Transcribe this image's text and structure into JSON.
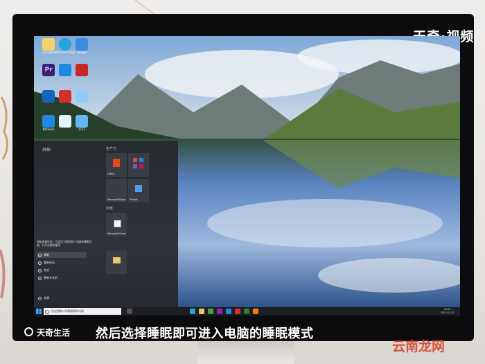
{
  "colors": {
    "accent": "#d9432c",
    "screen_bg": "#2f5e9a",
    "taskbar": "#1e1f23",
    "start_menu": "#26282c"
  },
  "brand_corner": "天奇·视频",
  "desktop_icons": [
    {
      "label": "Calculator",
      "icon": "calc-icon",
      "color": "#f5d36b"
    },
    {
      "label": "Microsoft Edge",
      "icon": "edge-icon",
      "color": "#2aa3d8"
    },
    {
      "label": "Google",
      "icon": "app-icon",
      "color": "#3d8be0"
    },
    {
      "label": "Pr",
      "icon": "premiere-icon",
      "color": "#3a1f6e"
    },
    {
      "label": "",
      "icon": "app-icon",
      "color": "#1e88e5"
    },
    {
      "label": "",
      "icon": "app-icon",
      "color": "#c62828"
    },
    {
      "label": "",
      "icon": "app-icon",
      "color": "#1565c0"
    },
    {
      "label": "",
      "icon": "app-icon",
      "color": "#d32f2f"
    },
    {
      "label": "",
      "icon": "app-icon",
      "color": "#90caf9"
    },
    {
      "label": "Network",
      "icon": "network-icon",
      "color": "#1e88e5"
    },
    {
      "label": "",
      "icon": "app-icon",
      "color": "#e3f2fd"
    },
    {
      "label": "ICST",
      "icon": "app-icon",
      "color": "#64b5f6"
    }
  ],
  "start_menu": {
    "title": "开始",
    "section_label": "生产力",
    "tiles": [
      {
        "label": "Office",
        "color": "#3a3d44",
        "icon": "office-icon"
      },
      {
        "label": "",
        "color": "#3a3d44",
        "icon": "apps-grid-icon"
      },
      {
        "label": "Microsoft Edge",
        "color": "#3a3d44",
        "icon": "edge-icon"
      },
      {
        "label": "Photos",
        "color": "#3a3d44",
        "icon": "photos-icon"
      },
      {
        "label": "Microsoft Store",
        "color": "#3a3d44",
        "icon": "store-icon"
      },
      {
        "label": "",
        "color": "#3a3d44",
        "icon": "folder-icon"
      }
    ],
    "explore_label": "浏览",
    "notice": "电脑未操作时，可设定为使用较少电量的睡眠状态，打开设置来更改",
    "power_items": [
      "睡眠",
      "重新启动",
      "关机",
      "更新并关机"
    ],
    "power_label": "电源"
  },
  "taskbar": {
    "search_placeholder": "在这里输入你要搜索的内容",
    "time": "14:21",
    "date": "2021/11/11"
  },
  "footer": {
    "logo_text": "天奇生活",
    "caption": "然后选择睡眠即可进入电脑的睡眠模式"
  },
  "watermark": "云南龙网"
}
